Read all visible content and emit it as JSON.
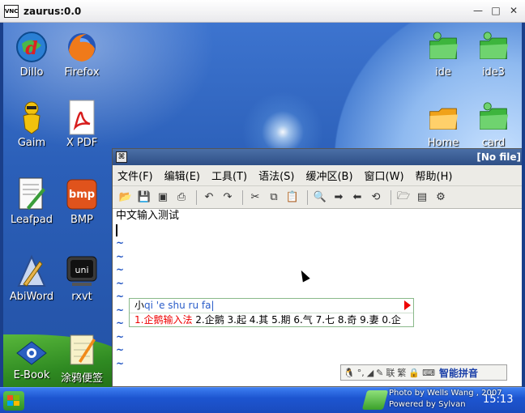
{
  "window": {
    "title": "zaurus:0.0",
    "logo_text": "VNC",
    "minimize": "—",
    "maximize": "□",
    "close": "✕"
  },
  "desktop": {
    "icons": [
      {
        "label": "Dillo",
        "icon": "dillo-icon"
      },
      {
        "label": "Firefox",
        "icon": "firefox-icon"
      },
      {
        "label": "Gaim",
        "icon": "gaim-icon"
      },
      {
        "label": "X PDF",
        "icon": "pdf-icon"
      },
      {
        "label": "Leafpad",
        "icon": "leafpad-icon"
      },
      {
        "label": "BMP",
        "icon": "bmp-icon"
      },
      {
        "label": "AbiWord",
        "icon": "abiword-icon"
      },
      {
        "label": "rxvt",
        "icon": "terminal-icon"
      },
      {
        "label": "E-Book",
        "icon": "ebook-icon"
      },
      {
        "label": "涂鸦便签",
        "icon": "notepad-icon"
      },
      {
        "label": "ide",
        "icon": "folder-icon"
      },
      {
        "label": "ide3",
        "icon": "folder-icon"
      },
      {
        "label": "Home",
        "icon": "home-folder-icon"
      },
      {
        "label": "card",
        "icon": "folder-icon"
      }
    ],
    "bmp_badge": "bmp",
    "uni_badge": "uni"
  },
  "editor": {
    "file_status": "[No file]",
    "menu": [
      "文件(F)",
      "编辑(E)",
      "工具(T)",
      "语法(S)",
      "缓冲区(B)",
      "窗口(W)",
      "帮助(H)"
    ],
    "first_line": "中文输入测试",
    "tilde": "~"
  },
  "ime": {
    "preedit_prefix": "小",
    "preedit_pinyin": "qi 'e shu ru fa",
    "preedit_cursor": "|",
    "first_candidate": "1.企鹅输入法",
    "candidates": "2.企鹅 3.起 4.其 5.期 6.气 7.七 8.奇 9.妻 0.企",
    "status_mode": "智能拼音",
    "status_labels": [
      "联",
      "繁"
    ]
  },
  "taskbar": {
    "photo_credit_1": "Photo by Wells Wang , 2007",
    "photo_credit_2": "Powered by Sylvan",
    "clock": "15:13"
  }
}
